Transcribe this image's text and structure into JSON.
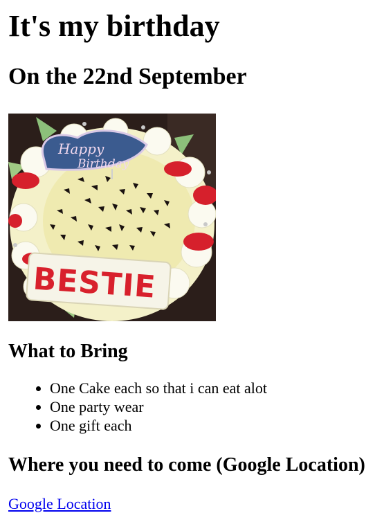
{
  "page": {
    "title": "It's my birthday",
    "subtitle": "On the 22nd September",
    "image": {
      "alt_text": "Happy Birthday BESTIE cake",
      "topper_text_line1": "Happy",
      "topper_text_line2": "Birthday",
      "lettering": "BESTIE"
    },
    "bring_heading": "What to Bring",
    "bring_items": [
      "One Cake each so that i can eat alot",
      "One party wear",
      "One gift each"
    ],
    "location_heading": "Where you need to come (Google Location)",
    "location_link": "Google Location"
  },
  "colors": {
    "link": "#0000ee",
    "text": "#000000",
    "background": "#ffffff"
  }
}
